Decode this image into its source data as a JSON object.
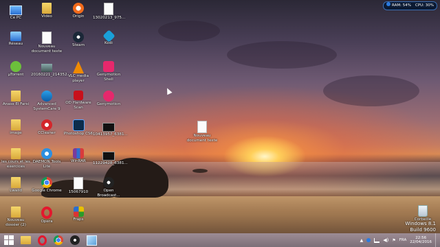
{
  "sysmon": {
    "ram": "RAM: 54%",
    "cpu": "CPU: 30%"
  },
  "desktop_icons": [
    {
      "label": "Ce PC",
      "icon": "pc-icon"
    },
    {
      "label": "Vidéo",
      "icon": "folder-icon"
    },
    {
      "label": "Origin",
      "icon": "origin-icon"
    },
    {
      "label": "13020213_975...",
      "icon": "document-icon"
    },
    {
      "label": "Réseau",
      "icon": "network-icon"
    },
    {
      "label": "Nouveau document texte",
      "icon": "text-document-icon"
    },
    {
      "label": "Steam",
      "icon": "steam-icon"
    },
    {
      "label": "Kodi",
      "icon": "kodi-icon"
    },
    {
      "label": "µTorrent",
      "icon": "utorrent-icon"
    },
    {
      "label": "20160221_214352...",
      "icon": "image-icon"
    },
    {
      "label": "VLC media player",
      "icon": "vlc-icon"
    },
    {
      "label": "Genymotion Shell",
      "icon": "genymotion-shell-icon"
    },
    {
      "label": "Anass El Farsi",
      "icon": "user-folder-icon"
    },
    {
      "label": "Advanced SystemCare 9",
      "icon": "systemcare-icon"
    },
    {
      "label": "OD Hardware Scan",
      "icon": "hardware-scan-icon"
    },
    {
      "label": "Genymotion",
      "icon": "genymotion-icon"
    },
    {
      "label": "image",
      "icon": "folder-icon"
    },
    {
      "label": "CCleaner",
      "icon": "ccleaner-icon"
    },
    {
      "label": "Photoshop CS6",
      "icon": "photoshop-icon"
    },
    {
      "label": "10413957_6381...",
      "icon": "video-icon"
    },
    {
      "label": "Nouveau document texte",
      "icon": "text-document-icon"
    },
    {
      "label": "les cours et les exercices",
      "icon": "folder-icon"
    },
    {
      "label": "DAEMON Tools Lite",
      "icon": "daemon-tools-icon"
    },
    {
      "label": "WinRAR",
      "icon": "winrar-icon"
    },
    {
      "label": "11229428_6381...",
      "icon": "video-icon"
    },
    {
      "label": "Lwalid",
      "icon": "folder-icon"
    },
    {
      "label": "Google Chrome",
      "icon": "chrome-icon"
    },
    {
      "label": "15067910",
      "icon": "document-icon"
    },
    {
      "label": "Open Broadcast...",
      "icon": "obs-icon"
    },
    {
      "label": "Nouveau dossier (2)",
      "icon": "folder-icon"
    },
    {
      "label": "Opera",
      "icon": "opera-icon"
    },
    {
      "label": "Fraps",
      "icon": "fraps-icon"
    },
    {
      "label": "Corbeille",
      "icon": "recycle-bin-icon"
    }
  ],
  "watermark": {
    "line1": "Windows 8.1",
    "line2": "Build 9600"
  },
  "taskbar": {
    "apps": [
      "start-icon",
      "file-explorer-icon",
      "opera-icon",
      "chrome-icon",
      "obs-icon",
      "notepad-icon"
    ]
  },
  "tray": {
    "language": "FRA",
    "time": "22:56",
    "date": "22/04/2016"
  },
  "colors": {
    "accent": "#2b7be0",
    "folder": "#e8c14f"
  }
}
